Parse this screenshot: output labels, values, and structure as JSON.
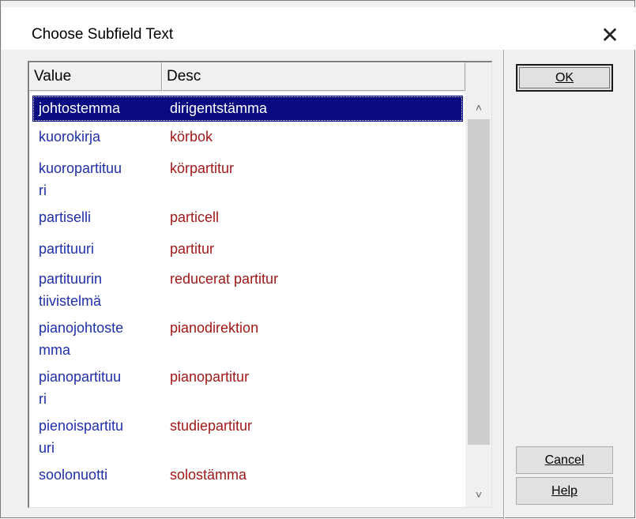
{
  "window": {
    "title": "Choose Subfield Text",
    "close_glyph": "✕"
  },
  "list": {
    "columns": [
      "Value",
      "Desc"
    ],
    "rows": [
      {
        "value": "johtostemma",
        "desc": "dirigentstämma",
        "selected": true
      },
      {
        "value": "kuorokirja",
        "desc": "körbok"
      },
      {
        "value": "kuoropartituu\nri",
        "desc": "körpartitur"
      },
      {
        "value": "partiselli",
        "desc": "particell"
      },
      {
        "value": "partituuri",
        "desc": "partitur"
      },
      {
        "value": "partituurin\ntiivistelmä",
        "desc": "reducerat partitur"
      },
      {
        "value": "pianojohtoste\nmma",
        "desc": "pianodirektion"
      },
      {
        "value": "pianopartituu\nri",
        "desc": "pianopartitur"
      },
      {
        "value": "pienoispartitu\nuri",
        "desc": "studiepartitur"
      },
      {
        "value": "soolonuotti",
        "desc": "solostämma"
      }
    ]
  },
  "buttons": {
    "ok": "OK",
    "cancel": "Cancel",
    "help": "Help"
  },
  "icons": {
    "scroll_up": "chevron-up-icon",
    "scroll_down": "chevron-down-icon",
    "close": "close-icon"
  },
  "colors": {
    "value_text": "#1f2fa8",
    "desc_text": "#a01818",
    "selection": "#0a0a80"
  }
}
